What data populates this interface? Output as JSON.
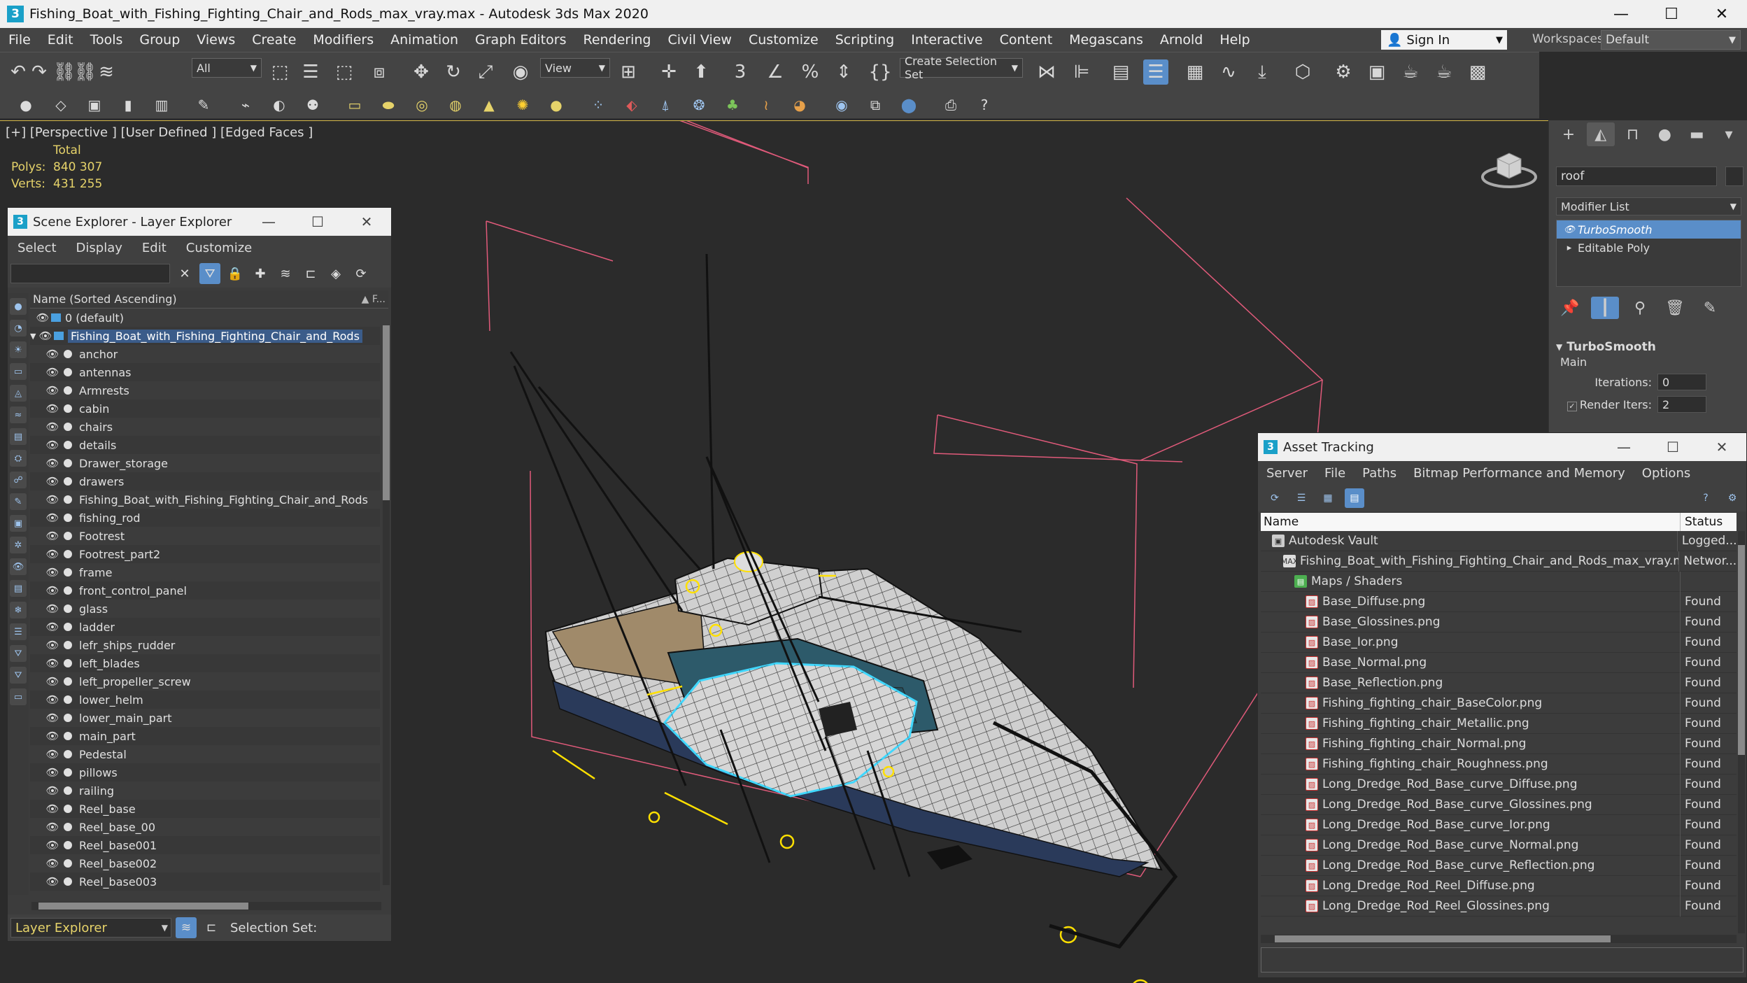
{
  "titlebar": {
    "title": "Fishing_Boat_with_Fishing_Fighting_Chair_and_Rods_max_vray.max - Autodesk 3ds Max 2020",
    "logo": "3"
  },
  "menu": [
    "File",
    "Edit",
    "Tools",
    "Group",
    "Views",
    "Create",
    "Modifiers",
    "Animation",
    "Graph Editors",
    "Rendering",
    "Civil View",
    "Customize",
    "Scripting",
    "Interactive",
    "Content",
    "Megascans",
    "Arnold",
    "Help"
  ],
  "signin": {
    "label": "Sign In"
  },
  "workspaces": {
    "label": "Workspaces:",
    "value": "Default"
  },
  "toolbar": {
    "filter_value": "All",
    "refcoord_value": "View",
    "selset_value": "Create Selection Set"
  },
  "viewport": {
    "label": "[+] [Perspective ] [User Defined ] [Edged Faces ]",
    "stats_header": "Total",
    "polys_label": "Polys:",
    "polys_value": "840 307",
    "verts_label": "Verts:",
    "verts_value": "431 255"
  },
  "scene_explorer": {
    "title": "Scene Explorer - Layer Explorer",
    "menu": [
      "Select",
      "Display",
      "Edit",
      "Customize"
    ],
    "header": "Name (Sorted Ascending)",
    "header_sort": "▲ F...",
    "layers": [
      {
        "name": "0 (default)",
        "level": 1
      },
      {
        "name": "Fishing_Boat_with_Fishing_Fighting_Chair_and_Rods",
        "level": 1,
        "selected": true
      }
    ],
    "objects": [
      "anchor",
      "antennas",
      "Armrests",
      "cabin",
      "chairs",
      "details",
      "Drawer_storage",
      "drawers",
      "Fishing_Boat_with_Fishing_Fighting_Chair_and_Rods",
      "fishing_rod",
      "Footrest",
      "Footrest_part2",
      "frame",
      "front_control_panel",
      "glass",
      "ladder",
      "lefr_ships_rudder",
      "left_blades",
      "left_propeller_screw",
      "lower_helm",
      "lower_main_part",
      "main_part",
      "Pedestal",
      "pillows",
      "railing",
      "Reel_base",
      "Reel_base_00",
      "Reel_base001",
      "Reel_base002",
      "Reel_base003"
    ],
    "footer_mode": "Layer Explorer",
    "footer_selset": "Selection Set:"
  },
  "command_panel": {
    "object_name": "roof",
    "modifier_list": "Modifier List",
    "stack": [
      {
        "name": "TurboSmooth",
        "selected": true
      },
      {
        "name": "Editable Poly",
        "selected": false
      }
    ],
    "rollout_title": "TurboSmooth",
    "rollout_sub": "Main",
    "iterations_label": "Iterations:",
    "iterations_value": "0",
    "render_iters_label": "Render Iters:",
    "render_iters_value": "2"
  },
  "asset_tracking": {
    "title": "Asset Tracking",
    "menu": [
      "Server",
      "File",
      "Paths",
      "Bitmap Performance and Memory",
      "Options"
    ],
    "col_name": "Name",
    "col_status": "Status",
    "rows": [
      {
        "name": "Autodesk Vault",
        "status": "Logged...",
        "level": 0,
        "icon": "vault"
      },
      {
        "name": "Fishing_Boat_with_Fishing_Fighting_Chair_and_Rods_max_vray.max",
        "status": "Networ...",
        "level": 1,
        "icon": "max"
      },
      {
        "name": "Maps / Shaders",
        "status": "",
        "level": 2,
        "icon": "folder"
      },
      {
        "name": "Base_Diffuse.png",
        "status": "Found",
        "level": 3,
        "icon": "png"
      },
      {
        "name": "Base_Glossines.png",
        "status": "Found",
        "level": 3,
        "icon": "png"
      },
      {
        "name": "Base_Ior.png",
        "status": "Found",
        "level": 3,
        "icon": "png"
      },
      {
        "name": "Base_Normal.png",
        "status": "Found",
        "level": 3,
        "icon": "png"
      },
      {
        "name": "Base_Reflection.png",
        "status": "Found",
        "level": 3,
        "icon": "png"
      },
      {
        "name": "Fishing_fighting_chair_BaseColor.png",
        "status": "Found",
        "level": 3,
        "icon": "png"
      },
      {
        "name": "Fishing_fighting_chair_Metallic.png",
        "status": "Found",
        "level": 3,
        "icon": "png"
      },
      {
        "name": "Fishing_fighting_chair_Normal.png",
        "status": "Found",
        "level": 3,
        "icon": "png"
      },
      {
        "name": "Fishing_fighting_chair_Roughness.png",
        "status": "Found",
        "level": 3,
        "icon": "png"
      },
      {
        "name": "Long_Dredge_Rod_Base_curve_Diffuse.png",
        "status": "Found",
        "level": 3,
        "icon": "png"
      },
      {
        "name": "Long_Dredge_Rod_Base_curve_Glossines.png",
        "status": "Found",
        "level": 3,
        "icon": "png"
      },
      {
        "name": "Long_Dredge_Rod_Base_curve_Ior.png",
        "status": "Found",
        "level": 3,
        "icon": "png"
      },
      {
        "name": "Long_Dredge_Rod_Base_curve_Normal.png",
        "status": "Found",
        "level": 3,
        "icon": "png"
      },
      {
        "name": "Long_Dredge_Rod_Base_curve_Reflection.png",
        "status": "Found",
        "level": 3,
        "icon": "png"
      },
      {
        "name": "Long_Dredge_Rod_Reel_Diffuse.png",
        "status": "Found",
        "level": 3,
        "icon": "png"
      },
      {
        "name": "Long_Dredge_Rod_Reel_Glossines.png",
        "status": "Found",
        "level": 3,
        "icon": "png"
      }
    ]
  },
  "colors": {
    "accent": "#5a8ec9",
    "stats": "#e6d36a",
    "bbox": "#e05a7a",
    "selection": "#ffe000",
    "selected_obj": "#40d8ff"
  }
}
